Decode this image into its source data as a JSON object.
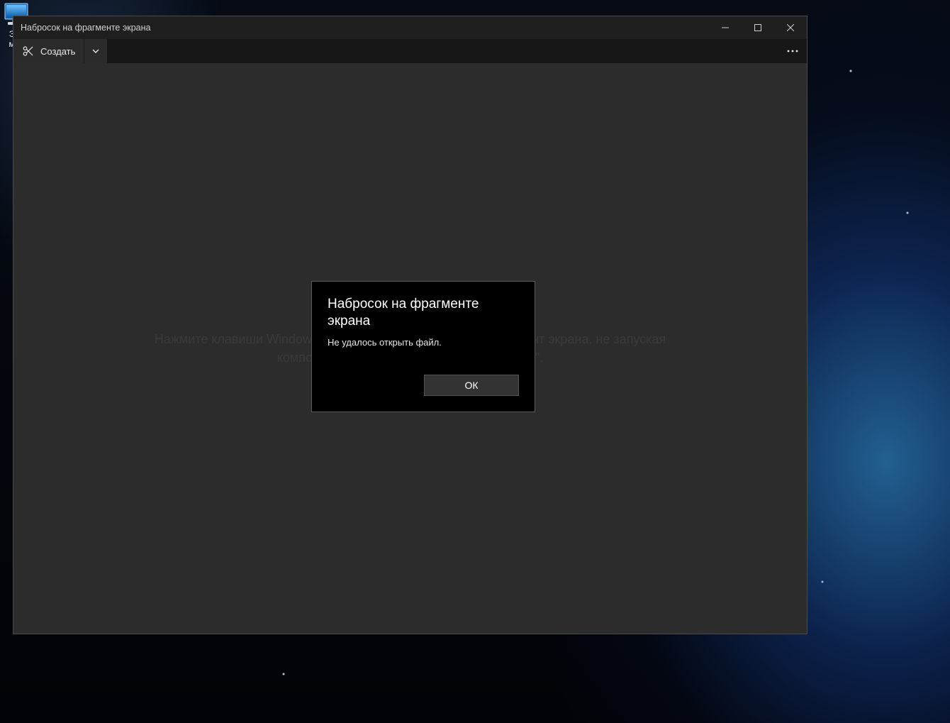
{
  "desktop": {
    "icon_label_line1": "Это",
    "icon_label_line2": "мпь"
  },
  "window": {
    "title": "Набросок на фрагменте экрана",
    "toolbar": {
      "new_label": "Создать"
    },
    "hint": "Нажмите клавиши Windows + Shift + S, чтобы вырезать фрагмент экрана, не запуская компонент \"Набросок на фрагменте экрана\"."
  },
  "dialog": {
    "title": "Набросок на фрагменте экрана",
    "message": "Не удалось открыть файл.",
    "ok_label": "ОК"
  }
}
